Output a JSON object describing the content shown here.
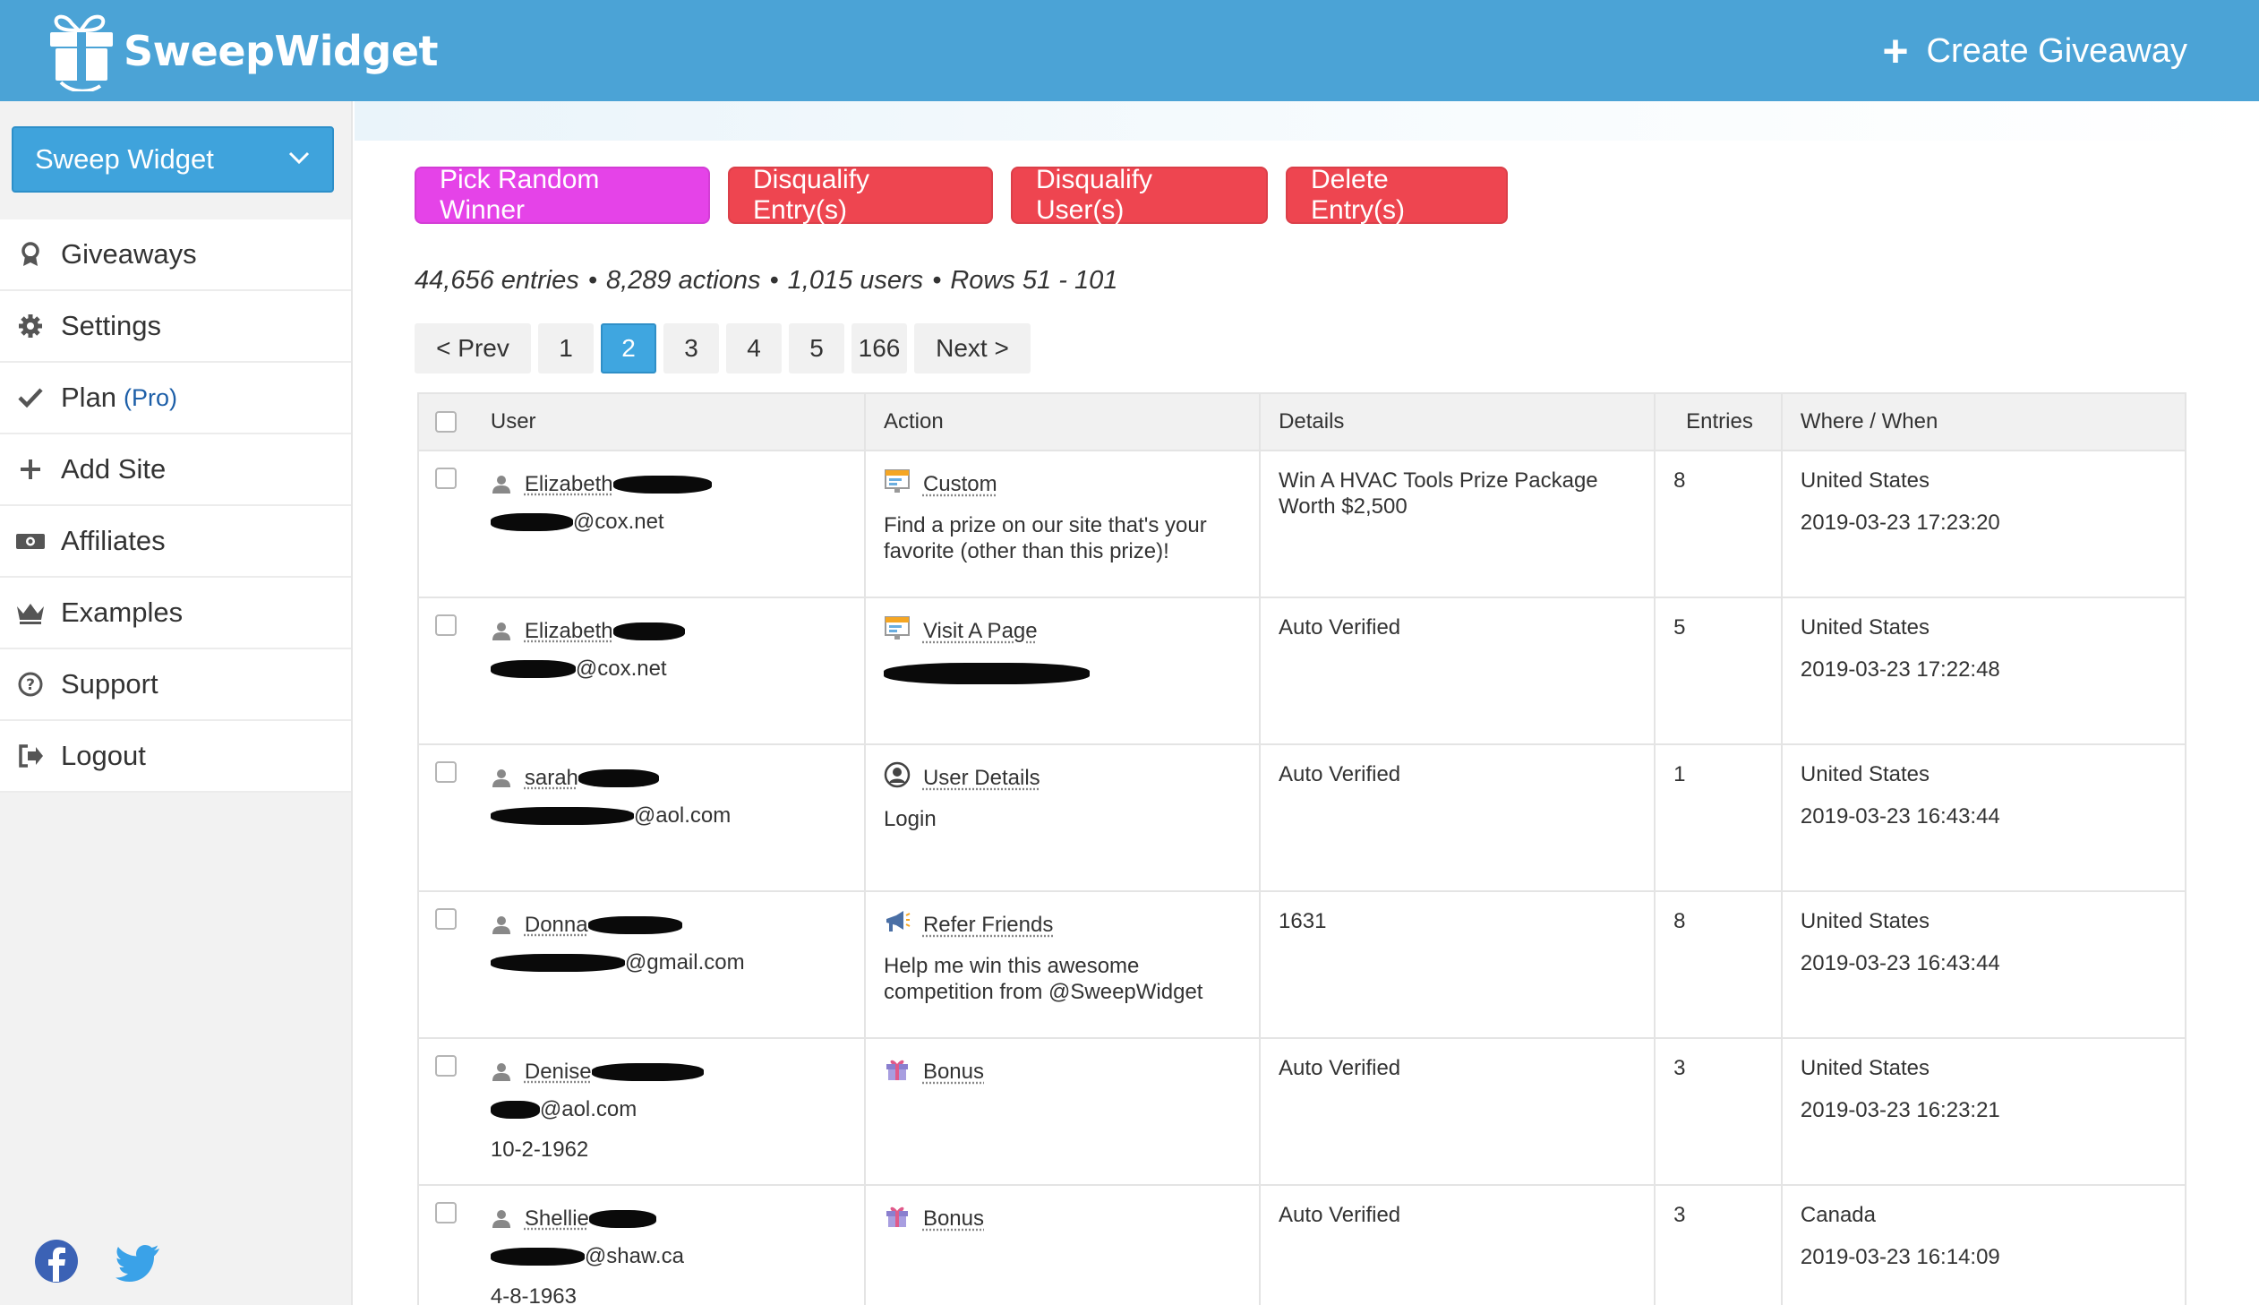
{
  "header": {
    "brand": "SweepWidget",
    "create_label": "Create Giveaway"
  },
  "sidebar": {
    "site_select": "Sweep Widget",
    "items": [
      {
        "icon": "award-icon",
        "label": "Giveaways"
      },
      {
        "icon": "gear-icon",
        "label": "Settings"
      },
      {
        "icon": "check-icon",
        "label": "Plan",
        "badge": "(Pro)"
      },
      {
        "icon": "plus-icon",
        "label": "Add Site"
      },
      {
        "icon": "money-icon",
        "label": "Affiliates"
      },
      {
        "icon": "crown-icon",
        "label": "Examples"
      },
      {
        "icon": "question-circle-icon",
        "label": "Support"
      },
      {
        "icon": "logout-icon",
        "label": "Logout"
      }
    ],
    "social": [
      "facebook-icon",
      "twitter-icon"
    ]
  },
  "actions": {
    "pick_winner": "Pick Random Winner",
    "disqualify_entry": "Disqualify Entry(s)",
    "disqualify_user": "Disqualify User(s)",
    "delete_entry": "Delete Entry(s)"
  },
  "stats": {
    "entries": "44,656 entries",
    "actions": "8,289 actions",
    "users": "1,015 users",
    "rows": "Rows 51 - 101",
    "separator": "•"
  },
  "pagination": {
    "prev": "< Prev",
    "pages": [
      "1",
      "2",
      "3",
      "4",
      "5",
      "166"
    ],
    "active": "2",
    "next": "Next >"
  },
  "table": {
    "columns": [
      "User",
      "Action",
      "Details",
      "Entries",
      "Where / When"
    ],
    "rows": [
      {
        "name": "Elizabeth",
        "email": "@cox.net",
        "dob": "",
        "action": "Custom",
        "action_icon": "form-icon",
        "action_desc": "Find a prize on our site that's your favorite (other than this prize)!",
        "details": "Win A HVAC Tools Prize Package Worth $2,500",
        "entries": "8",
        "where": "United States",
        "when": "2019-03-23 17:23:20"
      },
      {
        "name": "Elizabeth",
        "email": "@cox.net",
        "dob": "",
        "action": "Visit A Page",
        "action_icon": "form-icon",
        "action_desc": "",
        "details": "Auto Verified",
        "entries": "5",
        "where": "United States",
        "when": "2019-03-23 17:22:48"
      },
      {
        "name": "sarah",
        "email": "@aol.com",
        "dob": "",
        "action": "User Details",
        "action_icon": "user-circle-icon",
        "action_desc": "Login",
        "details": "Auto Verified",
        "entries": "1",
        "where": "United States",
        "when": "2019-03-23 16:43:44"
      },
      {
        "name": "Donna",
        "email": "@gmail.com",
        "dob": "",
        "action": "Refer Friends",
        "action_icon": "megaphone-icon",
        "action_desc": "Help me win this awesome competition from @SweepWidget",
        "details": "1631",
        "entries": "8",
        "where": "United States",
        "when": "2019-03-23 16:43:44"
      },
      {
        "name": "Denise",
        "email": "@aol.com",
        "dob": "10-2-1962",
        "action": "Bonus",
        "action_icon": "gift-icon",
        "action_desc": "",
        "details": "Auto Verified",
        "entries": "3",
        "where": "United States",
        "when": "2019-03-23 16:23:21"
      },
      {
        "name": "Shellie",
        "email": "@shaw.ca",
        "dob": "4-8-1963",
        "action": "Bonus",
        "action_icon": "gift-icon",
        "action_desc": "",
        "details": "Auto Verified",
        "entries": "3",
        "where": "Canada",
        "when": "2019-03-23 16:14:09"
      }
    ]
  },
  "colors": {
    "header": "#4ba3d6",
    "pick_winner": "#e543e8",
    "danger": "#ee4550",
    "active_page": "#3fa6e0"
  }
}
